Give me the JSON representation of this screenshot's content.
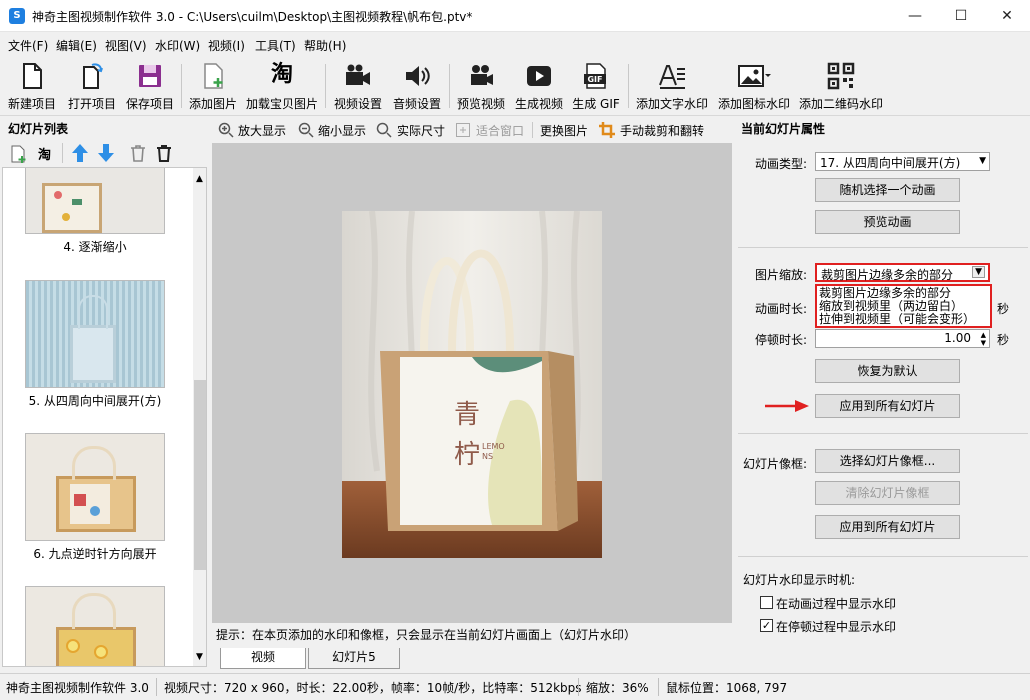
{
  "title": {
    "text": "神奇主图视频制作软件 3.0 - C:\\Users\\cuilm\\Desktop\\主图视频教程\\帆布包.ptv*",
    "app_icon": "S",
    "minimize": "—",
    "maximize": "☐",
    "close": "✕"
  },
  "menu": [
    "文件(F)",
    "编辑(E)",
    "视图(V)",
    "水印(W)",
    "视频(I)",
    "工具(T)",
    "帮助(H)"
  ],
  "toolbar": {
    "new": "新建项目",
    "open": "打开项目",
    "save": "保存项目",
    "add_image": "添加图片",
    "load_taobao": "加载宝贝图片",
    "video_settings": "视频设置",
    "audio_settings": "音频设置",
    "preview_video": "预览视频",
    "generate_video": "生成视频",
    "generate_gif": "生成 GIF",
    "text_watermark": "添加文字水印",
    "icon_watermark": "添加图标水印",
    "qr_watermark": "添加二维码水印",
    "taobao_glyph": "淘",
    "gif_glyph": "GIF"
  },
  "slides": {
    "header": "幻灯片列表",
    "taobao_glyph": "淘",
    "items": [
      {
        "caption": "4. 逐渐缩小"
      },
      {
        "caption": "5. 从四周向中间展开(方)"
      },
      {
        "caption": "6. 九点逆时针方向展开"
      },
      {
        "caption": ""
      }
    ]
  },
  "center": {
    "zoom_in": "放大显示",
    "zoom_out": "缩小显示",
    "actual_size": "实际尺寸",
    "fit_window": "适合窗口",
    "replace_image": "更换图片",
    "manual_crop": "手动裁剪和翻转",
    "product_text_1": "青",
    "product_text_2": "柠",
    "product_text_3": "LEMO",
    "product_text_4": "NS",
    "hint": "提示：在本页添加的水印和像框，只会显示在当前幻灯片画面上（幻灯片水印）",
    "tabs": [
      "视频",
      "幻灯片5"
    ]
  },
  "props": {
    "header": "当前幻灯片属性",
    "anim_type_label": "动画类型:",
    "anim_type_value": "17. 从四周向中间展开(方)",
    "random_anim": "随机选择一个动画",
    "preview_anim": "预览动画",
    "scale_label": "图片缩放:",
    "scale_value": "裁剪图片边缘多余的部分",
    "scale_options": [
      "裁剪图片边缘多余的部分",
      "缩放到视频里（两边留白）",
      "拉伸到视频里（可能会变形）"
    ],
    "anim_duration_label": "动画时长:",
    "sec": "秒",
    "pause_label": "停顿时长:",
    "pause_value": "1.00",
    "reset_default": "恢复为默认",
    "apply_all": "应用到所有幻灯片",
    "frame_label": "幻灯片像框:",
    "choose_frame": "选择幻灯片像框...",
    "clear_frame": "清除幻灯片像框",
    "apply_all_frame": "应用到所有幻灯片",
    "watermark_timing_label": "幻灯片水印显示时机:",
    "show_during_anim": "在动画过程中显示水印",
    "show_during_anim_checked": false,
    "show_during_pause": "在停顿过程中显示水印",
    "show_during_pause_checked": true
  },
  "status": {
    "app": "神奇主图视频制作软件 3.0",
    "video_info": "视频尺寸：720 x 960，时长：22.00秒，帧率：10帧/秒，比特率：512kbps",
    "zoom": "缩放：36%",
    "mouse": "鼠标位置：1068, 797"
  },
  "colors": {
    "accent_red": "#e02020",
    "arrow_blue": "#2e8fe6"
  }
}
